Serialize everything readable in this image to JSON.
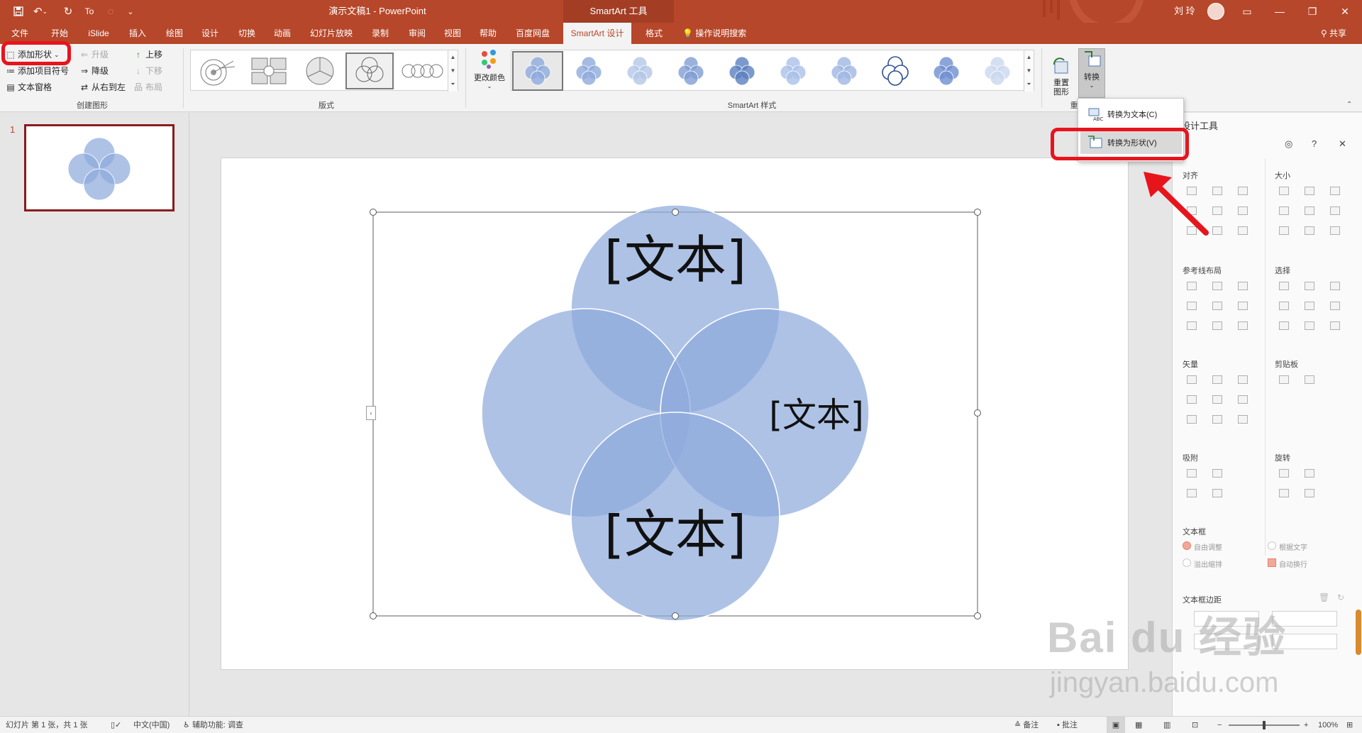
{
  "titlebar": {
    "title": "演示文稿1  -  PowerPoint",
    "tool_tab": "SmartArt 工具",
    "user": "刘 玲",
    "qa_icons": [
      "save-icon",
      "undo-icon",
      "redo-icon",
      "format-painter-icon",
      "customize-icon"
    ],
    "window_buttons": [
      "ribbon-display-icon",
      "minimize-icon",
      "maximize-icon",
      "close-icon"
    ]
  },
  "tabs": [
    {
      "label": "文件"
    },
    {
      "label": "开始"
    },
    {
      "label": "iSlide"
    },
    {
      "label": "插入"
    },
    {
      "label": "绘图"
    },
    {
      "label": "设计"
    },
    {
      "label": "切换"
    },
    {
      "label": "动画"
    },
    {
      "label": "幻灯片放映"
    },
    {
      "label": "录制"
    },
    {
      "label": "审阅"
    },
    {
      "label": "视图"
    },
    {
      "label": "帮助"
    },
    {
      "label": "百度网盘"
    },
    {
      "label": "SmartArt 设计"
    },
    {
      "label": "格式"
    }
  ],
  "tell_me": "操作说明搜索",
  "share": "共享",
  "ribbon": {
    "create": {
      "add_shape": "添加形状",
      "add_bullet": "添加项目符号",
      "text_pane": "文本窗格",
      "promote": "升级",
      "demote": "降级",
      "rtl": "从右到左",
      "move_up": "上移",
      "move_down": "下移",
      "layout": "布局",
      "group": "创建图形"
    },
    "layouts_group": "版式",
    "change_colors": "更改颜色",
    "styles_group": "SmartArt 样式",
    "reset_graphic": "重置\n图形",
    "convert": "转换",
    "reset_group": "重"
  },
  "convert_menu": {
    "to_text": "转换为文本(C)",
    "to_shapes": "转换为形状(V)"
  },
  "slide_panel": {
    "number": "1"
  },
  "slide": {
    "texts": [
      "[文本]",
      "[文本]",
      "[文本]"
    ],
    "circle_color": "#8faadc"
  },
  "pane": {
    "title": "设计工具",
    "align": "对齐",
    "size": "大小",
    "guides": "参考线布局",
    "select": "选择",
    "vector": "矢量",
    "clipboard": "剪贴板",
    "snap": "吸附",
    "rotate": "旋转",
    "textbox": "文本框",
    "autofit": "自由调整",
    "fit_text": "根据文字",
    "overflow": "溢出缩排",
    "wrap": "自动换行",
    "margins": "文本框边距"
  },
  "status": {
    "slide_info": "幻灯片 第 1 张，共 1 张",
    "language": "中文(中国)",
    "accessibility": "辅助功能: 调查",
    "notes": "备注",
    "comments": "批注",
    "zoom": "100%"
  },
  "watermark": {
    "brand": "Bai du 经验",
    "url": "jingyan.baidu.com"
  }
}
